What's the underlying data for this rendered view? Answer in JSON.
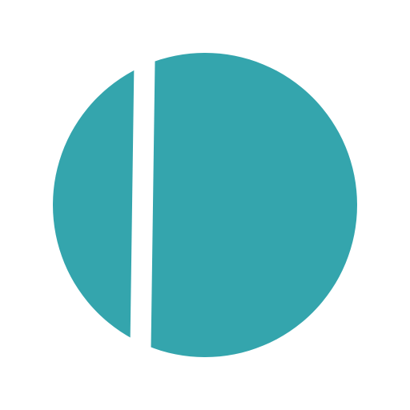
{
  "logo": {
    "icon": "split-circle-icon",
    "colors": {
      "background": "#ffffff",
      "circle": "#34a5ad",
      "divider": "#ffffff"
    }
  }
}
